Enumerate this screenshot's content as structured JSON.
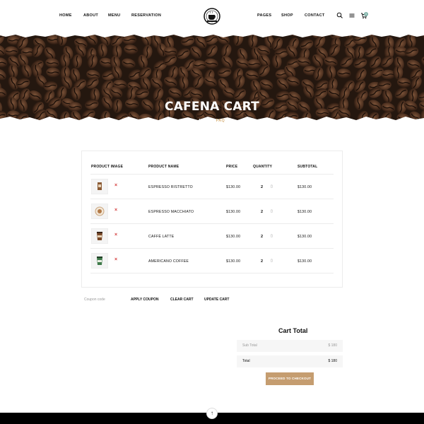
{
  "nav": {
    "left_items": [
      "HOME",
      "ABOUT",
      "MENU",
      "RESERVATION"
    ],
    "right_items": [
      "PAGES",
      "SHOP",
      "CONTACT"
    ],
    "cart_count": "0",
    "icons": [
      "search-icon",
      "menu-icon",
      "cart-icon"
    ]
  },
  "hero": {
    "title": "CAFENA CART",
    "breadcrumb_home": "HOME",
    "breadcrumb_sep": "/",
    "breadcrumb_current": "FAQ"
  },
  "cart": {
    "headers": [
      "PRODUCT IMAGE",
      "PRODUCT NAME",
      "PRICE",
      "QUANTITY",
      "SUBTOTAL"
    ],
    "rows": [
      {
        "name": "ESPRESSO RISTRETTO",
        "price": "$130.00",
        "qty": "2",
        "subtotal": "$130.00",
        "remove": "×"
      },
      {
        "name": "ESPRESSO MACCHIATO",
        "price": "$130.00",
        "qty": "2",
        "subtotal": "$130.00",
        "remove": "×"
      },
      {
        "name": "CAFFÈ LATTE",
        "price": "$130.00",
        "qty": "2",
        "subtotal": "$130.00",
        "remove": "×"
      },
      {
        "name": "AMERICANO COFFEE",
        "price": "$130.00",
        "qty": "2",
        "subtotal": "$130.00",
        "remove": "×"
      }
    ]
  },
  "actions": {
    "coupon_placeholder": "Coupon code",
    "apply_coupon": "APPLY COUPON",
    "clear_cart": "CLEAR CART",
    "update_cart": "UPDATE CART"
  },
  "cart_total": {
    "title": "Cart Total",
    "subtotal_label": "Sub Total",
    "subtotal_value": "$ 180",
    "total_label": "Total",
    "total_value": "$ 180",
    "checkout_label": "PROCEED TO CHECKOUT"
  },
  "scroll_top": "↑",
  "colors": {
    "accent": "#c59d70",
    "remove": "#d43c3c",
    "footer": "#000000"
  }
}
